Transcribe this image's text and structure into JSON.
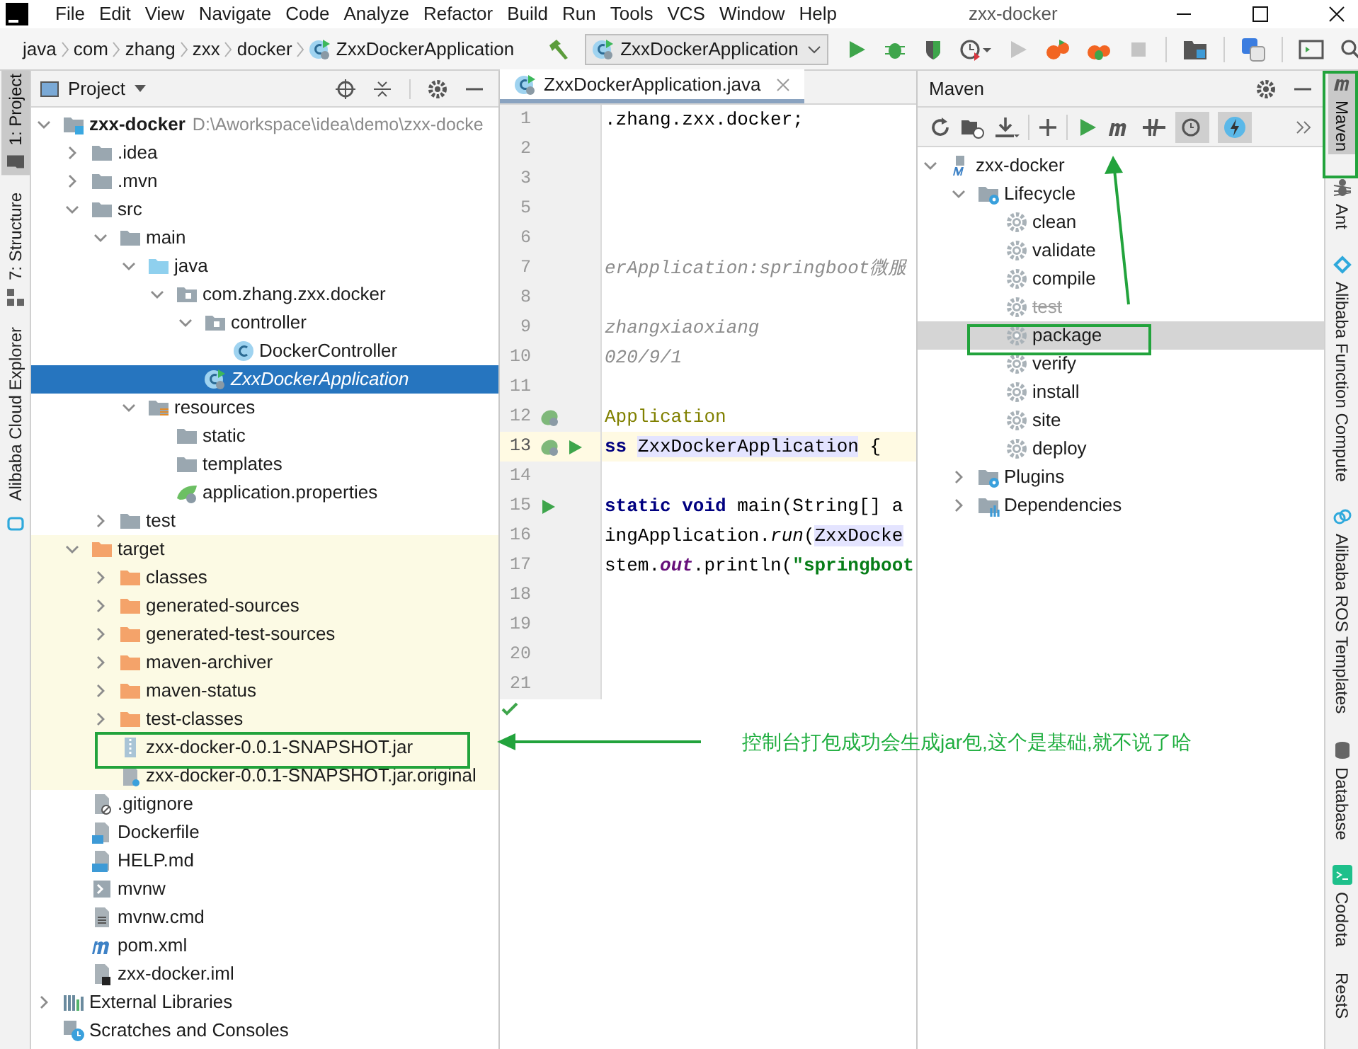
{
  "window": {
    "title": "zxx-docker"
  },
  "menu": [
    "File",
    "Edit",
    "View",
    "Navigate",
    "Code",
    "Analyze",
    "Refactor",
    "Build",
    "Run",
    "Tools",
    "VCS",
    "Window",
    "Help"
  ],
  "breadcrumbs": [
    "java",
    "com",
    "zhang",
    "zxx",
    "docker",
    "ZxxDockerApplication"
  ],
  "run_config": "ZxxDockerApplication",
  "left_tool_tabs": [
    {
      "label": "1: Project",
      "kind": "project",
      "selected": true
    },
    {
      "label": "7: Structure",
      "kind": "structure",
      "selected": false
    },
    {
      "label": "Alibaba Cloud Explorer",
      "kind": "cloud",
      "selected": false
    }
  ],
  "project": {
    "title": "Project",
    "tree": [
      {
        "label": "zxx-docker",
        "path": "D:\\Aworkspace\\idea\\demo\\zxx-docke",
        "kind": "module",
        "expanded": true,
        "selected": false,
        "children": [
          {
            "label": ".idea",
            "kind": "folder",
            "expanded": false,
            "selected": false,
            "excluded": false
          },
          {
            "label": ".mvn",
            "kind": "folder",
            "expanded": false,
            "selected": false,
            "excluded": false
          },
          {
            "label": "src",
            "kind": "folder",
            "expanded": true,
            "selected": false,
            "excluded": false,
            "children": [
              {
                "label": "main",
                "kind": "folder",
                "expanded": true,
                "selected": false,
                "children": [
                  {
                    "label": "java",
                    "kind": "folder-source",
                    "expanded": true,
                    "selected": false,
                    "children": [
                      {
                        "label": "com.zhang.zxx.docker",
                        "kind": "package",
                        "expanded": true,
                        "selected": false,
                        "children": [
                          {
                            "label": "controller",
                            "kind": "package",
                            "expanded": true,
                            "selected": false,
                            "children": [
                              {
                                "label": "DockerController",
                                "kind": "class",
                                "selected": false
                              }
                            ]
                          },
                          {
                            "label": "ZxxDockerApplication",
                            "kind": "spring-class",
                            "selected": true
                          }
                        ]
                      }
                    ]
                  },
                  {
                    "label": "resources",
                    "kind": "folder-resources",
                    "expanded": true,
                    "selected": false,
                    "children": [
                      {
                        "label": "static",
                        "kind": "folder",
                        "selected": false
                      },
                      {
                        "label": "templates",
                        "kind": "folder",
                        "selected": false
                      },
                      {
                        "label": "application.properties",
                        "kind": "properties",
                        "selected": false
                      }
                    ]
                  }
                ]
              },
              {
                "label": "test",
                "kind": "folder",
                "expanded": false,
                "selected": false
              }
            ]
          },
          {
            "label": "target",
            "kind": "folder-excluded",
            "expanded": true,
            "selected": false,
            "excluded": true,
            "children": [
              {
                "label": "classes",
                "kind": "folder-excluded",
                "expanded": false,
                "selected": false
              },
              {
                "label": "generated-sources",
                "kind": "folder-excluded",
                "expanded": false,
                "selected": false
              },
              {
                "label": "generated-test-sources",
                "kind": "folder-excluded",
                "expanded": false,
                "selected": false
              },
              {
                "label": "maven-archiver",
                "kind": "folder-excluded",
                "expanded": false,
                "selected": false
              },
              {
                "label": "maven-status",
                "kind": "folder-excluded",
                "expanded": false,
                "selected": false
              },
              {
                "label": "test-classes",
                "kind": "folder-excluded",
                "expanded": false,
                "selected": false
              },
              {
                "label": "zxx-docker-0.0.1-SNAPSHOT.jar",
                "kind": "jar",
                "selected": false
              },
              {
                "label": "zxx-docker-0.0.1-SNAPSHOT.jar.original",
                "kind": "unknown",
                "selected": false
              }
            ]
          },
          {
            "label": ".gitignore",
            "kind": "ignore",
            "selected": false,
            "excluded": false
          },
          {
            "label": "Dockerfile",
            "kind": "docker",
            "selected": false,
            "excluded": false
          },
          {
            "label": "HELP.md",
            "kind": "markdown",
            "selected": false,
            "excluded": false
          },
          {
            "label": "mvnw",
            "kind": "shell",
            "selected": false,
            "excluded": false
          },
          {
            "label": "mvnw.cmd",
            "kind": "text",
            "selected": false,
            "excluded": false
          },
          {
            "label": "pom.xml",
            "kind": "maven",
            "selected": false,
            "excluded": false
          },
          {
            "label": "zxx-docker.iml",
            "kind": "iml",
            "selected": false,
            "excluded": false
          }
        ]
      },
      {
        "label": "External Libraries",
        "kind": "libraries",
        "expanded": false,
        "selected": false
      },
      {
        "label": "Scratches and Consoles",
        "kind": "scratches",
        "selected": false
      }
    ]
  },
  "editor": {
    "tab": "ZxxDockerApplication.java",
    "lines": [
      {
        "number": "1",
        "current": false,
        "segments": [
          {
            "text": ".zhang.zxx.docker;",
            "kind": "plain"
          }
        ]
      },
      {
        "number": "2",
        "current": false
      },
      {
        "number": "3",
        "current": false
      },
      {
        "number": "5",
        "current": false
      },
      {
        "number": "6",
        "current": false
      },
      {
        "number": "7",
        "current": false,
        "segments": [
          {
            "text": "erApplication:springboot微服",
            "kind": "doc"
          }
        ]
      },
      {
        "number": "8",
        "current": false
      },
      {
        "number": "9",
        "current": false,
        "segments": [
          {
            "text": "zhangxiaoxiang",
            "kind": "doc"
          }
        ]
      },
      {
        "number": "10",
        "current": false,
        "segments": [
          {
            "text": "020/9/1",
            "kind": "doc"
          }
        ]
      },
      {
        "number": "11",
        "current": false
      },
      {
        "number": "12",
        "current": false,
        "markers": [
          {
            "kind": "bean"
          }
        ],
        "segments": [
          {
            "text": "Application",
            "kind": "annotation"
          }
        ]
      },
      {
        "number": "13",
        "current": true,
        "markers": [
          {
            "kind": "bean"
          },
          {
            "kind": "run"
          }
        ],
        "segments": [
          {
            "text": "ss ",
            "kind": "keyword"
          },
          {
            "text": "ZxxDockerApplication",
            "kind": "usage"
          },
          {
            "text": " {",
            "kind": "plain"
          }
        ]
      },
      {
        "number": "14",
        "current": false
      },
      {
        "number": "15",
        "current": false,
        "markers": [
          {
            "kind": "run"
          }
        ],
        "segments": [
          {
            "text": "static void",
            "kind": "keyword"
          },
          {
            "text": " main(String[] a",
            "kind": "plain"
          }
        ]
      },
      {
        "number": "16",
        "current": false,
        "segments": [
          {
            "text": "ingApplication.",
            "kind": "plain"
          },
          {
            "text": "run",
            "kind": "static-call"
          },
          {
            "text": "(",
            "kind": "plain"
          },
          {
            "text": "ZxxDocke",
            "kind": "usage"
          }
        ]
      },
      {
        "number": "17",
        "current": false,
        "segments": [
          {
            "text": "stem.",
            "kind": "plain"
          },
          {
            "text": "out",
            "kind": "field"
          },
          {
            "text": ".println(",
            "kind": "plain"
          },
          {
            "text": "\"springboot",
            "kind": "string"
          }
        ]
      },
      {
        "number": "18",
        "current": false
      },
      {
        "number": "19",
        "current": false
      },
      {
        "number": "20",
        "current": false
      },
      {
        "number": "21",
        "current": false
      }
    ]
  },
  "maven": {
    "title": "Maven",
    "tree": [
      {
        "label": "zxx-docker",
        "kind": "maven-module",
        "expanded": true,
        "selected": false,
        "children": [
          {
            "label": "Lifecycle",
            "kind": "lifecycle",
            "expanded": true,
            "selected": false,
            "children": [
              {
                "label": "clean",
                "kind": "goal",
                "selected": false,
                "skipped": false
              },
              {
                "label": "validate",
                "kind": "goal",
                "selected": false,
                "skipped": false
              },
              {
                "label": "compile",
                "kind": "goal",
                "selected": false,
                "skipped": false
              },
              {
                "label": "test",
                "kind": "goal",
                "selected": false,
                "skipped": true
              },
              {
                "label": "package",
                "kind": "goal",
                "selected": true,
                "skipped": false
              },
              {
                "label": "verify",
                "kind": "goal",
                "selected": false,
                "skipped": false
              },
              {
                "label": "install",
                "kind": "goal",
                "selected": false,
                "skipped": false
              },
              {
                "label": "site",
                "kind": "goal",
                "selected": false,
                "skipped": false
              },
              {
                "label": "deploy",
                "kind": "goal",
                "selected": false,
                "skipped": false
              }
            ]
          },
          {
            "label": "Plugins",
            "kind": "lifecycle",
            "expanded": false,
            "selected": false
          },
          {
            "label": "Dependencies",
            "kind": "dependencies",
            "expanded": false,
            "selected": false
          }
        ]
      }
    ]
  },
  "right_tool_tabs": [
    {
      "label": "Maven",
      "kind": "maven",
      "selected": true
    },
    {
      "label": "Ant",
      "kind": "ant",
      "selected": false
    },
    {
      "label": "Alibaba Function Compute",
      "kind": "function",
      "selected": false
    },
    {
      "label": "Alibaba ROS Templates",
      "kind": "ros",
      "selected": false
    },
    {
      "label": "Database",
      "kind": "database",
      "selected": false
    },
    {
      "label": "Codota",
      "kind": "codota",
      "selected": false
    },
    {
      "label": "RestS",
      "kind": "plain",
      "selected": false
    }
  ],
  "annotation": {
    "note": "控制台打包成功会生成jar包,这个是基础,就不说了哈"
  }
}
